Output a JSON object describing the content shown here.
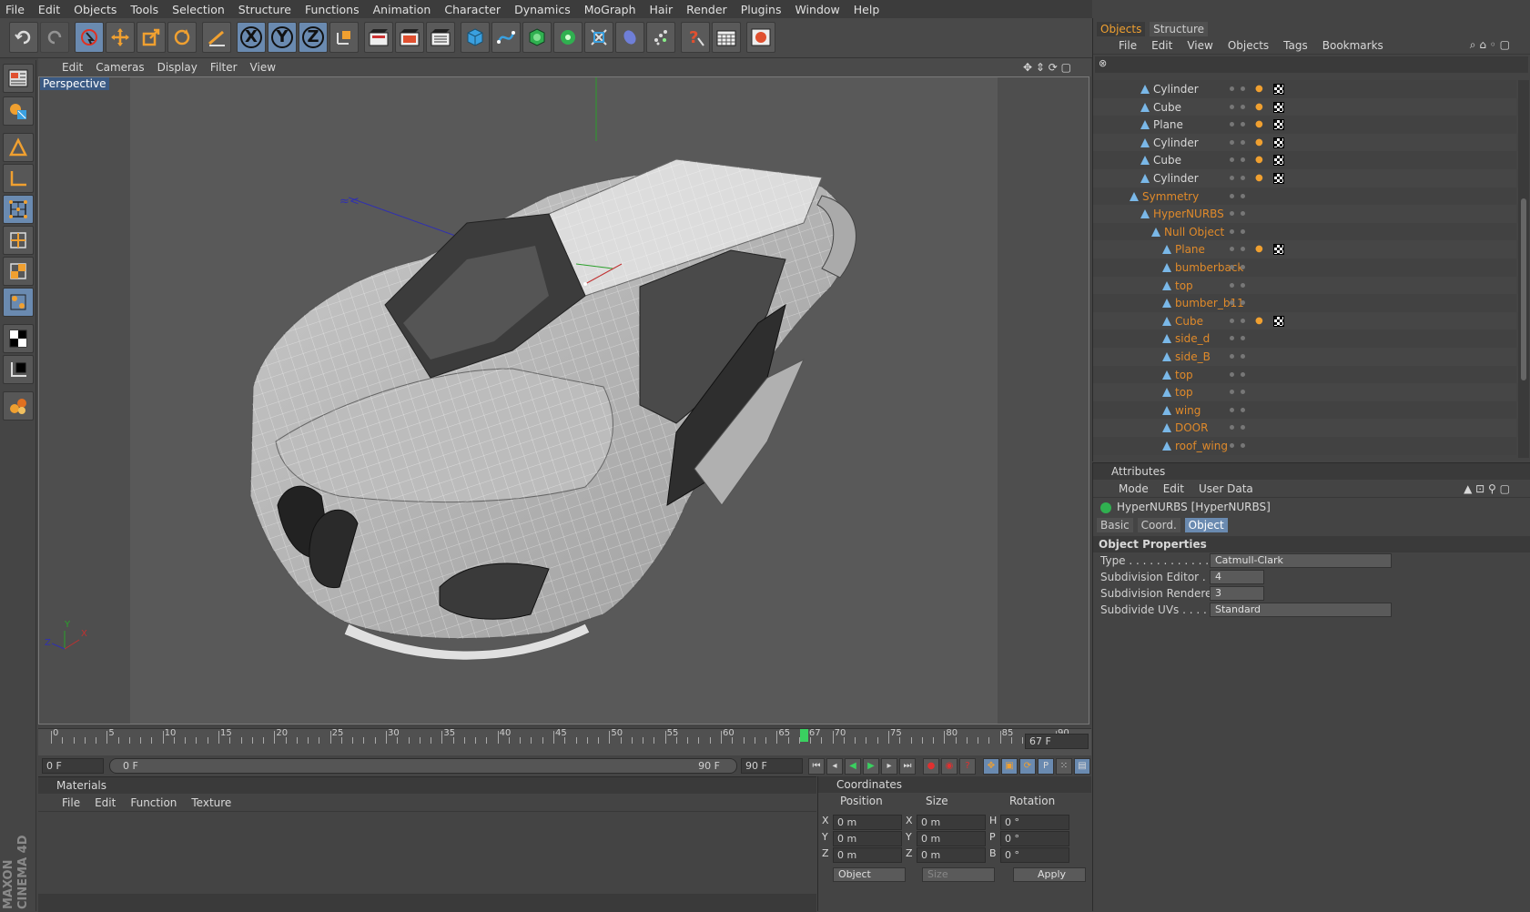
{
  "menu": [
    "File",
    "Edit",
    "Objects",
    "Tools",
    "Selection",
    "Structure",
    "Functions",
    "Animation",
    "Character",
    "Dynamics",
    "MoGraph",
    "Hair",
    "Render",
    "Plugins",
    "Window",
    "Help"
  ],
  "toolbar": {
    "xyz": [
      "X",
      "Y",
      "Z"
    ]
  },
  "viewport": {
    "menu": [
      "Edit",
      "Cameras",
      "Display",
      "Filter",
      "View"
    ],
    "label": "Perspective",
    "axis": {
      "x": "X",
      "y": "Y",
      "z": "Z"
    }
  },
  "timeline": {
    "ticks": [
      "0",
      "5",
      "10",
      "15",
      "20",
      "25",
      "30",
      "35",
      "40",
      "45",
      "50",
      "55",
      "60",
      "65",
      "67",
      "70",
      "75",
      "80",
      "85",
      "90"
    ],
    "current_frame": "67 F",
    "current_value": 67,
    "max_value": 90
  },
  "playbar": {
    "start": "0 F",
    "range_start": "0 F",
    "range_end": "90 F",
    "end": "90 F"
  },
  "materials": {
    "title": "Materials",
    "menu": [
      "File",
      "Edit",
      "Function",
      "Texture"
    ]
  },
  "coordinates": {
    "title": "Coordinates",
    "headers": [
      "Position",
      "Size",
      "Rotation"
    ],
    "rows": [
      {
        "a": "X",
        "p": "0 m",
        "b": "X",
        "s": "0 m",
        "c": "H",
        "r": "0 °"
      },
      {
        "a": "Y",
        "p": "0 m",
        "b": "Y",
        "s": "0 m",
        "c": "P",
        "r": "0 °"
      },
      {
        "a": "Z",
        "p": "0 m",
        "b": "Z",
        "s": "0 m",
        "c": "B",
        "r": "0 °"
      }
    ],
    "mode": "Object",
    "size_mode": "Size",
    "apply": "Apply"
  },
  "objects": {
    "tabs": [
      "Objects",
      "Structure"
    ],
    "menu": [
      "File",
      "Edit",
      "View",
      "Objects",
      "Tags",
      "Bookmarks"
    ],
    "items": [
      {
        "name": "Cylinder",
        "orange": false,
        "tags": true
      },
      {
        "name": "Cube",
        "orange": false,
        "tags": true
      },
      {
        "name": "Plane",
        "orange": false,
        "tags": true
      },
      {
        "name": "Cylinder",
        "orange": false,
        "tags": true
      },
      {
        "name": "Cube",
        "orange": false,
        "tags": true
      },
      {
        "name": "Cylinder",
        "orange": false,
        "tags": true
      },
      {
        "name": "Symmetry",
        "orange": true,
        "tags": false
      },
      {
        "name": "HyperNURBS",
        "orange": true,
        "tags": false
      },
      {
        "name": "Null Object",
        "orange": true,
        "tags": false
      },
      {
        "name": "Plane",
        "orange": true,
        "tags": true
      },
      {
        "name": "bumberback",
        "orange": true,
        "tags": false
      },
      {
        "name": "top",
        "orange": true,
        "tags": false
      },
      {
        "name": "bumber_b11",
        "orange": true,
        "tags": false
      },
      {
        "name": "Cube",
        "orange": true,
        "tags": true
      },
      {
        "name": "side_d",
        "orange": true,
        "tags": false
      },
      {
        "name": "side_B",
        "orange": true,
        "tags": false
      },
      {
        "name": "top",
        "orange": true,
        "tags": false
      },
      {
        "name": "top",
        "orange": true,
        "tags": false
      },
      {
        "name": "wing",
        "orange": true,
        "tags": false
      },
      {
        "name": "DOOR",
        "orange": true,
        "tags": false
      },
      {
        "name": "roof_wing",
        "orange": true,
        "tags": false
      }
    ]
  },
  "attributes": {
    "title": "Attributes",
    "menu": [
      "Mode",
      "Edit",
      "User Data"
    ],
    "object": "HyperNURBS [HyperNURBS]",
    "tabs": [
      "Basic",
      "Coord.",
      "Object"
    ],
    "section": "Object Properties",
    "props": [
      {
        "label": "Type . . . . . . . . . . . . . . .",
        "value": "Catmull-Clark"
      },
      {
        "label": "Subdivision Editor . . .",
        "value": "4"
      },
      {
        "label": "Subdivision Renderer",
        "value": "3"
      },
      {
        "label": "Subdivide UVs . . . . . . .",
        "value": "Standard"
      }
    ]
  },
  "brand": "MAXON CINEMA 4D",
  "colors": {
    "accent": "#f0a030",
    "selected": "#6a8ab0",
    "panel": "#444444"
  }
}
